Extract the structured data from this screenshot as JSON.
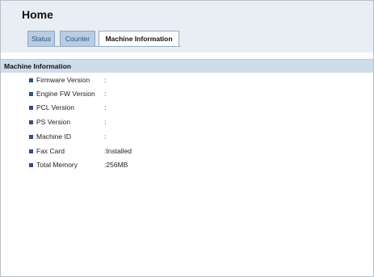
{
  "page": {
    "title": "Home"
  },
  "tabs": [
    {
      "label": "Status",
      "active": false
    },
    {
      "label": "Counter",
      "active": false
    },
    {
      "label": "Machine Information",
      "active": true
    }
  ],
  "section": {
    "title": "Machine Information"
  },
  "machine_info": [
    {
      "label": "Firmware Version",
      "value": ":"
    },
    {
      "label": "Engine FW Version",
      "value": ":"
    },
    {
      "label": "PCL Version",
      "value": ":"
    },
    {
      "label": "PS Version",
      "value": ":"
    },
    {
      "label": "Machine ID",
      "value": ":"
    },
    {
      "label": "Fax Card",
      "value": ":Installed"
    },
    {
      "label": "Total Memory",
      "value": ":256MB"
    }
  ],
  "colors": {
    "header_bg": "#e9eef5",
    "section_bg": "#cfdcea",
    "bullet": "#2f4f88",
    "inactive_tab_bg": "#b9cce3",
    "inactive_tab_text": "#2d4f80"
  }
}
